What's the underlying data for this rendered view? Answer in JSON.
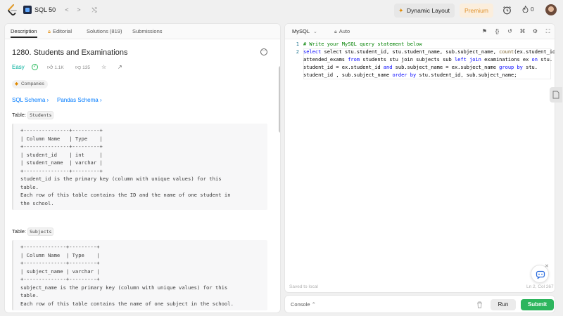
{
  "topbar": {
    "problem_list": "SQL 50",
    "prev": "<",
    "next": ">",
    "shuffle": "⤭",
    "dynamic_layout": "Dynamic Layout",
    "premium": "Premium",
    "streak_count": "0"
  },
  "left_tabs": {
    "description": "Description",
    "editorial": "Editorial",
    "solutions": "Solutions (819)",
    "submissions": "Submissions"
  },
  "problem": {
    "title": "1280. Students and Examinations",
    "difficulty": "Easy",
    "likes": "1.1K",
    "dislikes": "135",
    "companies": "Companies",
    "sql_schema": "SQL Schema",
    "pandas_schema": "Pandas Schema",
    "table_word": "Table: ",
    "students_table": "Students",
    "students_schema": [
      "+---------------+---------+",
      "| Column Name   | Type    |",
      "+---------------+---------+",
      "| student_id    | int     |",
      "| student_name  | varchar |",
      "+---------------+---------+",
      "student_id is the primary key (column with unique values) for this",
      "table.",
      "Each row of this table contains the ID and the name of one student in",
      "the school."
    ],
    "subjects_table": "Subjects",
    "subjects_schema": [
      "+--------------+---------+",
      "| Column Name  | Type    |",
      "+--------------+---------+",
      "| subject_name | varchar |",
      "+--------------+---------+",
      "subject_name is the primary key (column with unique values) for this",
      "table.",
      "Each row of this table contains the name of one subject in the school."
    ]
  },
  "editor": {
    "language": "MySQL",
    "mode": "Auto",
    "line_numbers": [
      "1",
      "2"
    ],
    "lines": {
      "l1": "# Write your MySQL query statement below",
      "l2a": "select stu.student_id, stu.student_name, sub.subject_name, ",
      "l2a_fn": "count",
      "l2a_end": "(ex.student_id)",
      "l2b_1": "attended_exams ",
      "l2b_from": "from",
      "l2b_2": " students stu join subjects sub ",
      "l2b_left": "left join",
      "l2b_3": " examinations ex ",
      "l2b_on": "on",
      "l2b_4": " stu.",
      "l2c_1": "student_id = ex.student_id ",
      "l2c_and": "and",
      "l2c_2": " sub.subject_name = ex.subject_name ",
      "l2c_group": "group by",
      "l2c_3": " stu.",
      "l2d_1": "student_id , sub.subject_name ",
      "l2d_order": "order by",
      "l2d_2": " stu.student_id, sub.subject_name;"
    },
    "saved": "Saved to local",
    "position": "Ln 2, Col 267"
  },
  "console": {
    "label": "Console",
    "run": "Run",
    "submit": "Submit"
  }
}
